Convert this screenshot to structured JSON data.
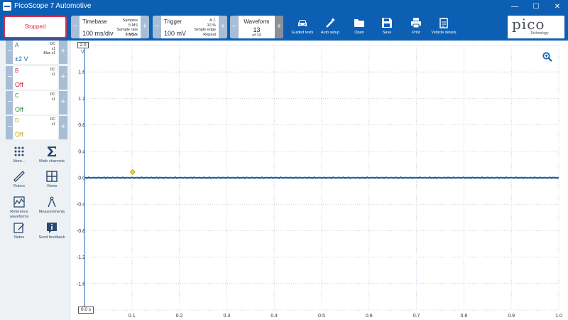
{
  "window": {
    "title": "PicoScope 7 Automotive",
    "minimize": "—",
    "maximize": "☐",
    "close": "✕"
  },
  "toolbar": {
    "run_state": "Stopped",
    "timebase": {
      "title": "Timebase",
      "value": "100 ms/div",
      "samples_label": "Samples",
      "samples_value": "5 MS",
      "rate_label": "Sample rate",
      "rate_value": "5 MS/s"
    },
    "trigger": {
      "title": "Trigger",
      "value": "100 mV",
      "channel": "A",
      "level": "10 %",
      "type": "Simple edge",
      "mode": "Repeat"
    },
    "waveform": {
      "title": "Waveform",
      "value": "13",
      "of": "of 13"
    },
    "buttons": [
      {
        "label": "Guided tests",
        "icon": "car-icon"
      },
      {
        "label": "Auto setup",
        "icon": "wand-icon"
      },
      {
        "label": "Open",
        "icon": "folder-icon"
      },
      {
        "label": "Save",
        "icon": "save-icon"
      },
      {
        "label": "Print",
        "icon": "printer-icon"
      },
      {
        "label": "Vehicle details",
        "icon": "clipboard-icon"
      }
    ],
    "logo_text": "pico",
    "logo_sub": "Technology"
  },
  "channels": [
    {
      "name": "A",
      "value": "±2 V",
      "info1": "DC",
      "info2": "x1",
      "info3": "Blue x1",
      "color": "#1b5fb5"
    },
    {
      "name": "B",
      "value": "Off",
      "info1": "DC",
      "info2": "x1",
      "info3": "",
      "color": "#d0213a"
    },
    {
      "name": "C",
      "value": "Off",
      "info1": "DC",
      "info2": "x1",
      "info3": "",
      "color": "#2a8a3a"
    },
    {
      "name": "D",
      "value": "Off",
      "info1": "DC",
      "info2": "x1",
      "info3": "",
      "color": "#c9a21a"
    }
  ],
  "side_tools": [
    {
      "label": "More...",
      "icon": "grid-dots-icon"
    },
    {
      "label": "Math channels",
      "icon": "sigma-icon"
    },
    {
      "label": "Rulers",
      "icon": "ruler-icon"
    },
    {
      "label": "Views",
      "icon": "views-icon"
    },
    {
      "label": "Reference waveforms",
      "icon": "reference-waveform-icon"
    },
    {
      "label": "Measurements",
      "icon": "compass-icon"
    },
    {
      "label": "Notes",
      "icon": "notes-icon"
    },
    {
      "label": "Send feedback",
      "icon": "info-icon"
    }
  ],
  "scope": {
    "y_unit": "V",
    "y_range_label": "2.0",
    "y_ticks": [
      "1.6",
      "1.2",
      "0.8",
      "0.4",
      "0.0",
      "-0.4",
      "-0.8",
      "-1.2",
      "-1.6",
      "-2.0"
    ],
    "x_ticks": [
      "0.0 s",
      "0.1",
      "0.2",
      "0.3",
      "0.4",
      "0.5",
      "0.6",
      "0.7",
      "0.8",
      "0.9",
      "1.0"
    ],
    "trace_color": "#1a5e9a",
    "trigger_marker_color": "#f2e01a"
  }
}
